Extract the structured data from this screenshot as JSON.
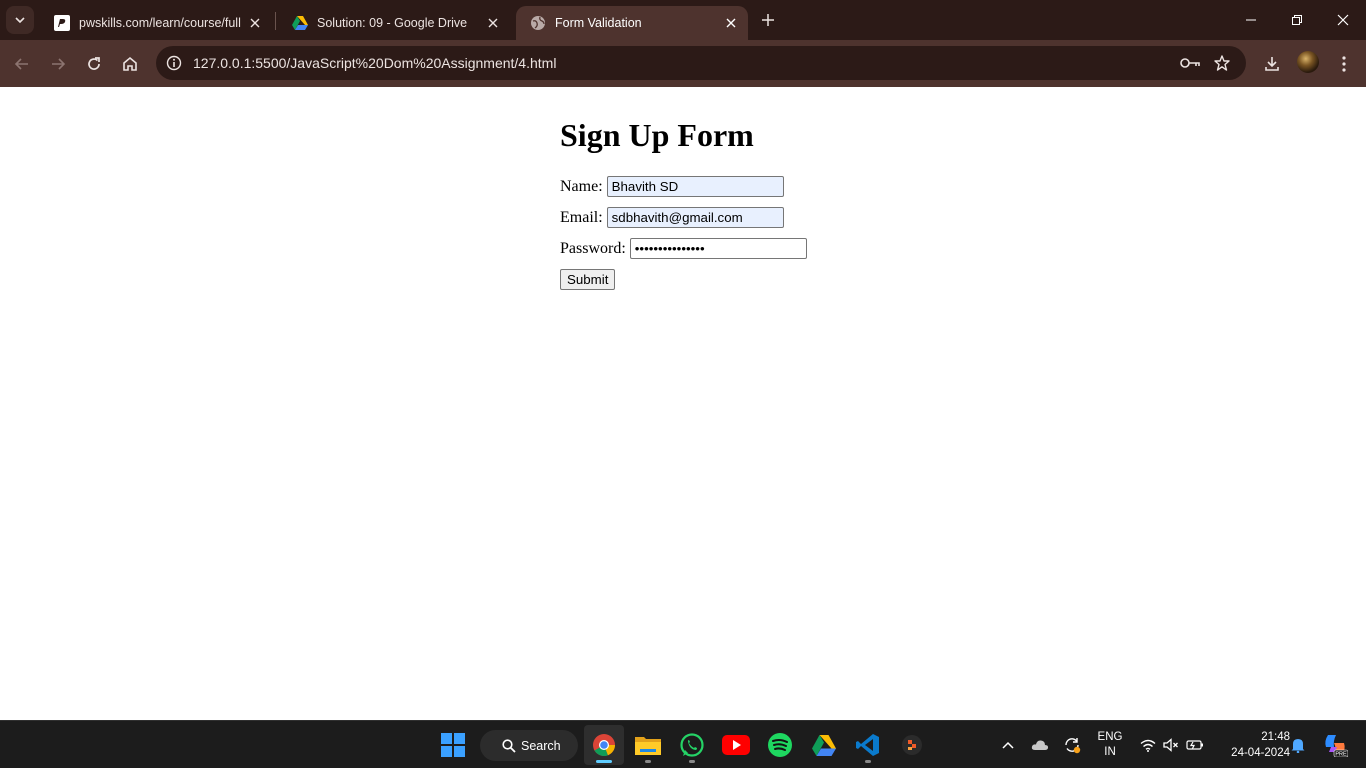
{
  "browser": {
    "tabs": [
      {
        "title": "pwskills.com/learn/course/full",
        "favicon": "pwskills-icon",
        "active": false
      },
      {
        "title": "Solution: 09 - Google Drive",
        "favicon": "google-drive-icon",
        "active": false
      },
      {
        "title": "Form Validation",
        "favicon": "globe-icon",
        "active": true
      }
    ],
    "address_bar": {
      "url": "127.0.0.1:5500/JavaScript%20Dom%20Assignment/4.html"
    }
  },
  "page": {
    "heading": "Sign Up Form",
    "fields": {
      "name": {
        "label": "Name:",
        "value": "Bhavith SD"
      },
      "email": {
        "label": "Email:",
        "value": "sdbhavith@gmail.com"
      },
      "password": {
        "label": "Password:",
        "value": "•••••••••••••••"
      }
    },
    "submit_label": "Submit"
  },
  "taskbar": {
    "search_label": "Search",
    "apps": [
      "windows-start-icon",
      "chrome-icon",
      "file-explorer-icon",
      "whatsapp-icon",
      "youtube-icon",
      "spotify-icon",
      "google-drive-icon",
      "vscode-icon",
      "app-icon"
    ],
    "language": {
      "line1": "ENG",
      "line2": "IN"
    },
    "clock": {
      "time": "21:48",
      "date": "24-04-2024"
    }
  },
  "colors": {
    "titlebar": "#2c1a17",
    "toolbar": "#4e332e",
    "autofill": "#e8f0fe",
    "taskbar": "#1c1c1c"
  }
}
